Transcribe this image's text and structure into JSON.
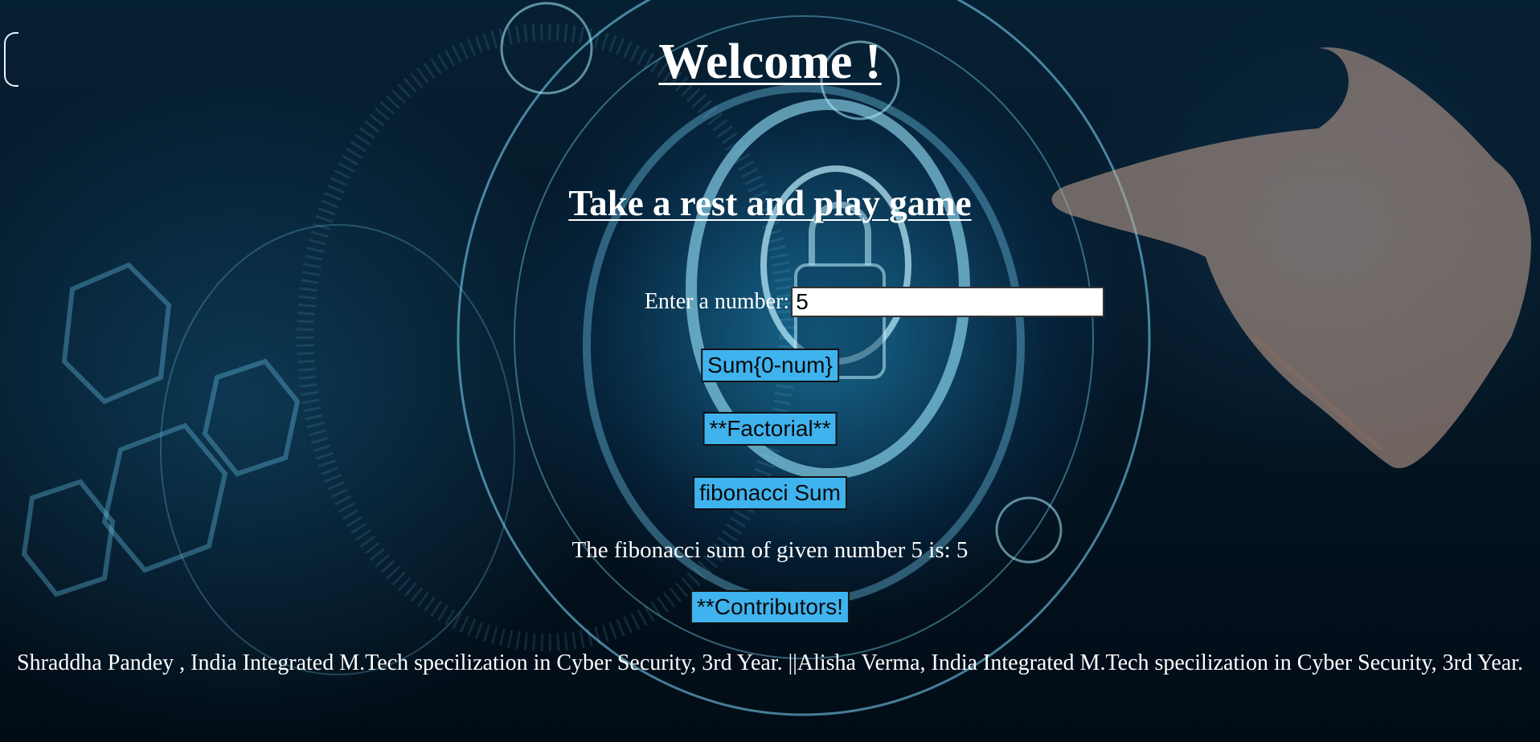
{
  "page": {
    "title": "Welcome !",
    "subtitle": "Take a rest and play game"
  },
  "form": {
    "label": "Enter a number:",
    "input_value": "5"
  },
  "buttons": {
    "sum_label": "Sum{0-num}",
    "factorial_label": "**Factorial**",
    "fibonacci_label": "fibonacci Sum",
    "contributors_label": "**Contributors!"
  },
  "result": {
    "text": "The fibonacci sum of given number 5 is: 5"
  },
  "contributors": {
    "text": "Shraddha Pandey , India Integrated M.Tech specilization in Cyber Security, 3rd Year. ||Alisha Verma, India Integrated M.Tech specilization in Cyber Security, 3rd Year."
  },
  "colors": {
    "button_background": "#3fb3ee",
    "text": "#ffffff",
    "background_glow": "#28aae6"
  },
  "background": {
    "icon": "cyber-security-lock-hand-image"
  }
}
